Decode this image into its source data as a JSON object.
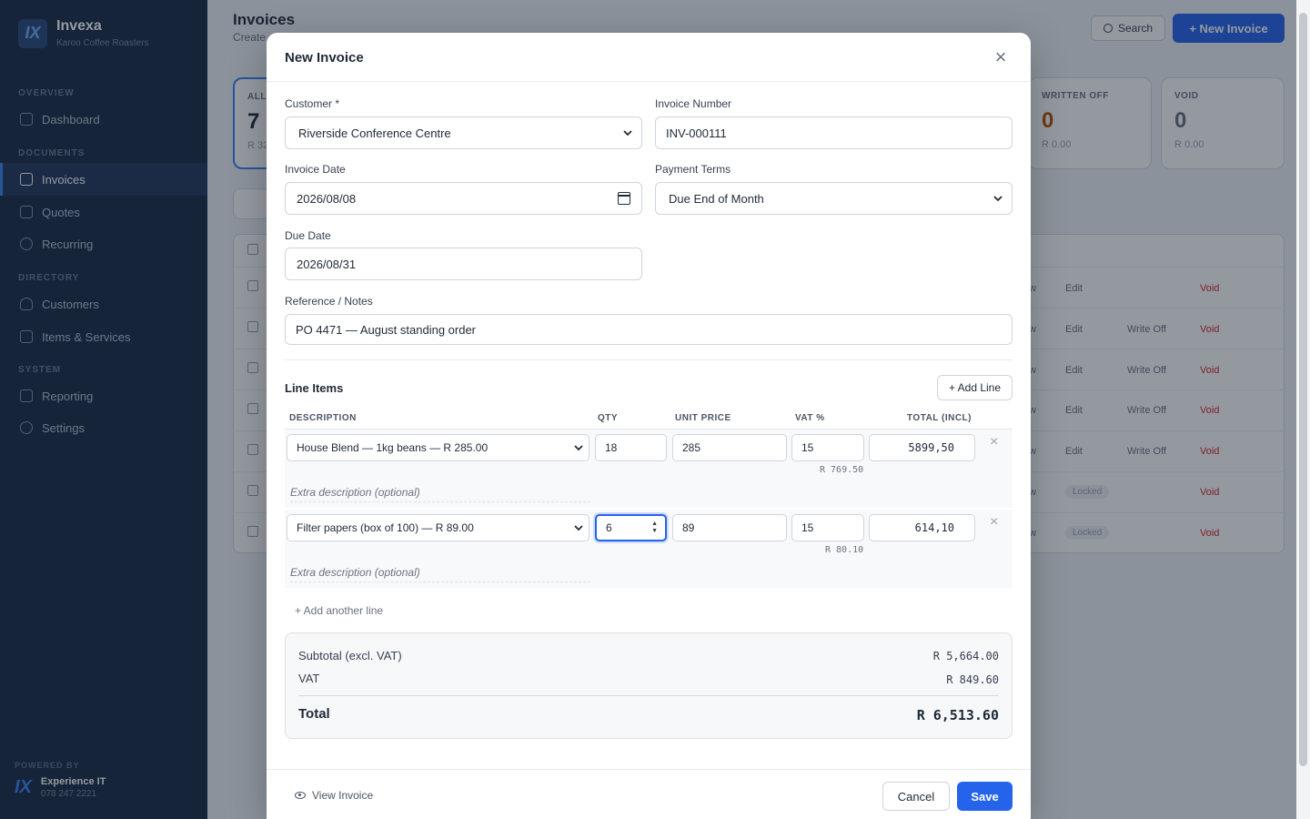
{
  "sidebar": {
    "brand": "Invexa",
    "company": "Karoo Coffee Roasters",
    "logo_text": "IX",
    "sections": {
      "overview": "OVERVIEW",
      "documents": "DOCUMENTS",
      "directory": "DIRECTORY",
      "system": "SYSTEM"
    },
    "items": {
      "dashboard": "Dashboard",
      "invoices": "Invoices",
      "quotes": "Quotes",
      "recurring": "Recurring",
      "customers": "Customers",
      "items_services": "Items & Services",
      "reporting": "Reporting",
      "settings": "Settings"
    },
    "powered_by": "POWERED BY",
    "footer_logo": "IX",
    "footer_name": "Experience IT",
    "footer_phone": "078 247 2221"
  },
  "page": {
    "title": "Invoices",
    "subtitle": "Create",
    "search_label": "Search",
    "new_invoice_label": "+ New Invoice",
    "stat_all_label": "ALL",
    "stat_all_num": "7",
    "stat_all_amt": "R 32",
    "stat_written_off_label": "WRITTEN OFF",
    "stat_written_off_num": "0",
    "stat_written_off_amt": "R 0.00",
    "stat_void_label": "VOID",
    "stat_void_num": "0",
    "stat_void_amt": "R 0.00",
    "row_actions": {
      "view_partial": "w",
      "edit": "Edit",
      "write_off": "Write Off",
      "void": "Void",
      "locked": "Locked"
    }
  },
  "modal": {
    "title": "New Invoice",
    "customer_label": "Customer *",
    "customer_value": "Riverside Conference Centre",
    "invoice_number_label": "Invoice Number",
    "invoice_number_value": "INV-000111",
    "invoice_date_label": "Invoice Date",
    "invoice_date_value": "2026/08/08",
    "payment_terms_label": "Payment Terms",
    "payment_terms_value": "Due End of Month",
    "due_date_label": "Due Date",
    "due_date_value": "2026/08/31",
    "reference_label": "Reference / Notes",
    "reference_value": "PO 4471 — August standing order",
    "line_items_title": "Line Items",
    "add_line_label": "+ Add Line",
    "headers": {
      "description": "DESCRIPTION",
      "qty": "QTY",
      "unit_price": "UNIT PRICE",
      "vat": "VAT %",
      "total": "TOTAL (INCL)"
    },
    "lines": [
      {
        "item": "House Blend — 1kg beans — R 285.00",
        "qty": "18",
        "unit_price": "285",
        "vat": "15",
        "total": "5899,50",
        "vat_amount": "R 769.50",
        "extra_placeholder": "Extra description (optional)"
      },
      {
        "item": "Filter papers (box of 100) — R 89.00",
        "qty": "6",
        "unit_price": "89",
        "vat": "15",
        "total": "614,10",
        "vat_amount": "R 80.10",
        "extra_placeholder": "Extra description (optional)"
      }
    ],
    "add_another_label": "+ Add another line",
    "subtotal_label": "Subtotal (excl. VAT)",
    "subtotal_value": "R 5,664.00",
    "vat_label": "VAT",
    "vat_value": "R 849.60",
    "total_label": "Total",
    "total_value": "R 6,513.60",
    "view_invoice_label": "View Invoice",
    "cancel_label": "Cancel",
    "save_label": "Save"
  },
  "colors": {
    "sidebar_bg": "#1a2a44",
    "accent": "#2563eb",
    "void_red": "#dc2626"
  }
}
